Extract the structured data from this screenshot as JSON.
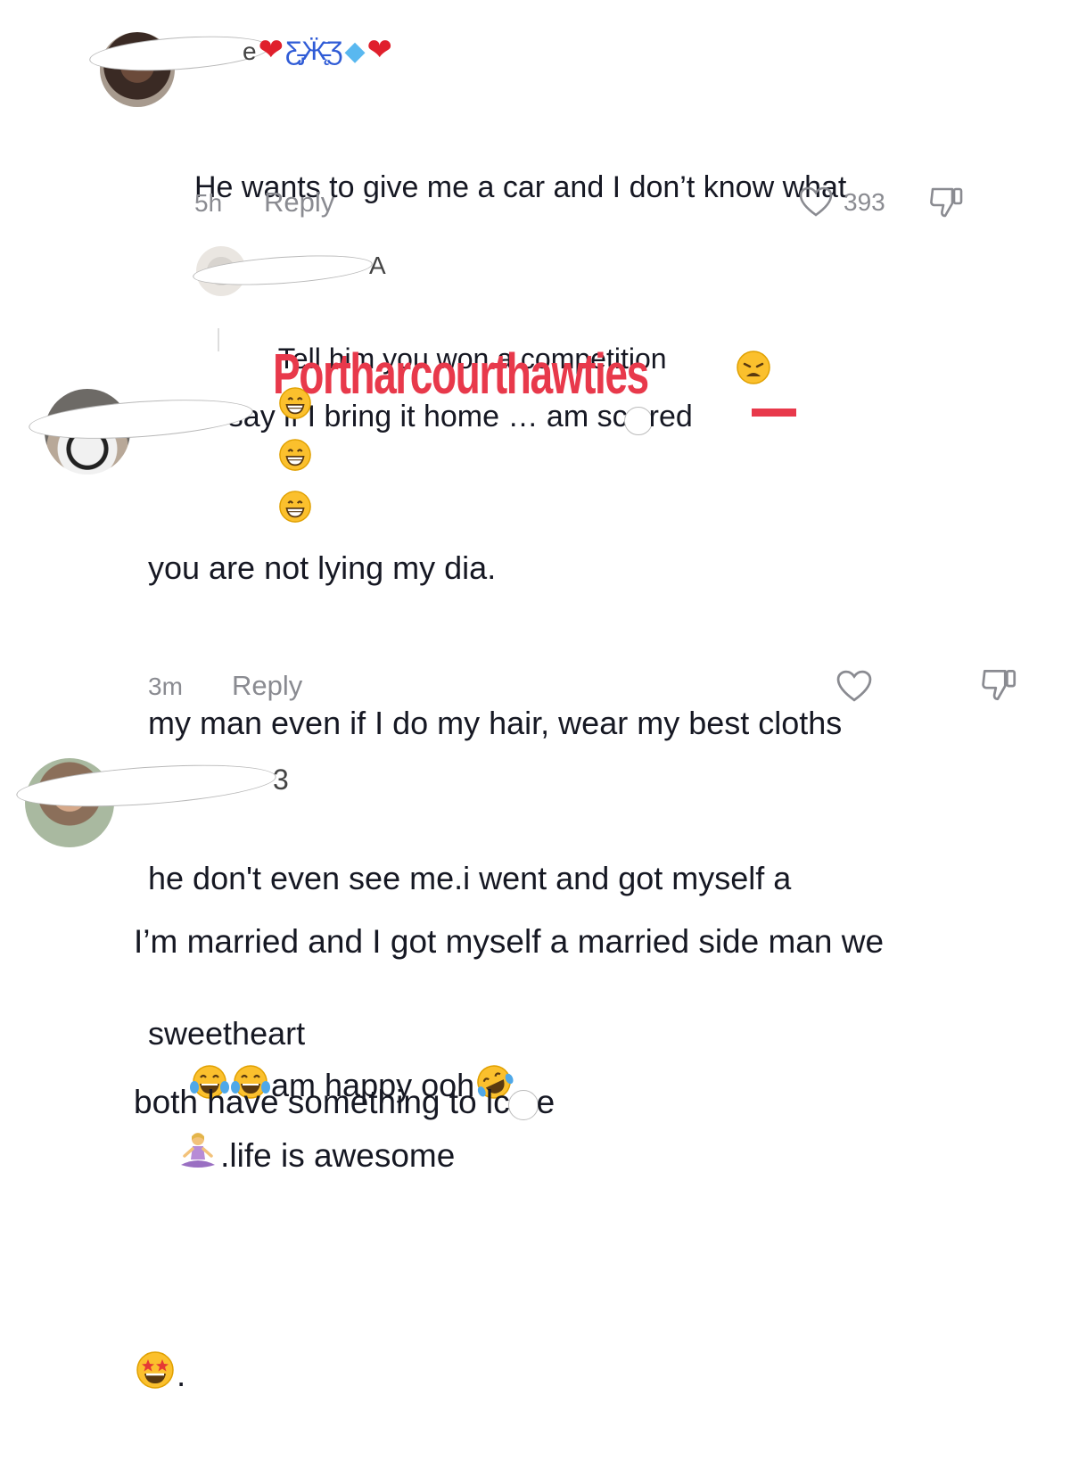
{
  "comments": [
    {
      "username_suffix": "e",
      "username_emojis": [
        "heart-emoji",
        "butterfly-emoji",
        "gem-emoji",
        "heart-emoji"
      ],
      "lines": [
        "He wants to give me a car and I don’t know what",
        "to say if I bring it home … am sc",
        "red"
      ],
      "time": "5h",
      "reply_label": "Reply",
      "like_count": "393"
    },
    {
      "username_suffix": "A",
      "lines": [
        "Tell him you won a competition"
      ],
      "trailing_emojis": [
        "grin-emoji",
        "grin-emoji",
        "grin-emoji"
      ]
    },
    {
      "lines": [
        "you are not lying my dia.",
        "my man even if I do my hair, wear my best cloths",
        "he don't even see me.i went and got myself a",
        "sweetheart",
        "am happy ooh"
      ],
      "time": "3m",
      "reply_label": "Reply"
    },
    {
      "username_suffix": "3",
      "lines": [
        "I’m married and I got myself a married side man we",
        "both have something to lc",
        "e",
        ".life is awesome",
        "."
      ]
    }
  ],
  "watermark": "Portharcourthawties"
}
